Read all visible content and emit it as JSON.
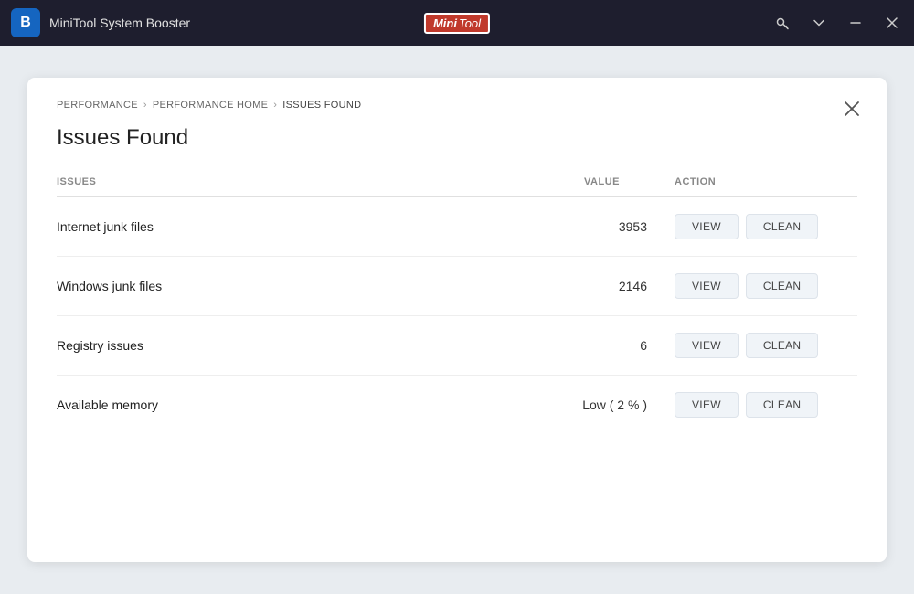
{
  "titlebar": {
    "logo_letter": "B",
    "app_title": "MiniTool System Booster",
    "brand_mini": "Mini",
    "brand_tool": "Tool",
    "controls": {
      "key_icon": "🔑",
      "chevron_icon": "∨",
      "minimize_icon": "—",
      "close_icon": "✕"
    }
  },
  "breadcrumb": {
    "items": [
      "PERFORMANCE",
      "PERFORMANCE HOME",
      "ISSUES FOUND"
    ],
    "separator": "›"
  },
  "card": {
    "close_icon": "✕",
    "page_title": "Issues Found",
    "columns": {
      "issues": "ISSUES",
      "value": "VALUE",
      "action": "ACTION"
    },
    "rows": [
      {
        "name": "Internet junk files",
        "value": "3953",
        "view_label": "VIEW",
        "clean_label": "CLEAN"
      },
      {
        "name": "Windows junk files",
        "value": "2146",
        "view_label": "VIEW",
        "clean_label": "CLEAN"
      },
      {
        "name": "Registry issues",
        "value": "6",
        "view_label": "VIEW",
        "clean_label": "CLEAN"
      },
      {
        "name": "Available memory",
        "value": "Low ( 2 % )",
        "view_label": "VIEW",
        "clean_label": "CLEAN"
      }
    ]
  }
}
